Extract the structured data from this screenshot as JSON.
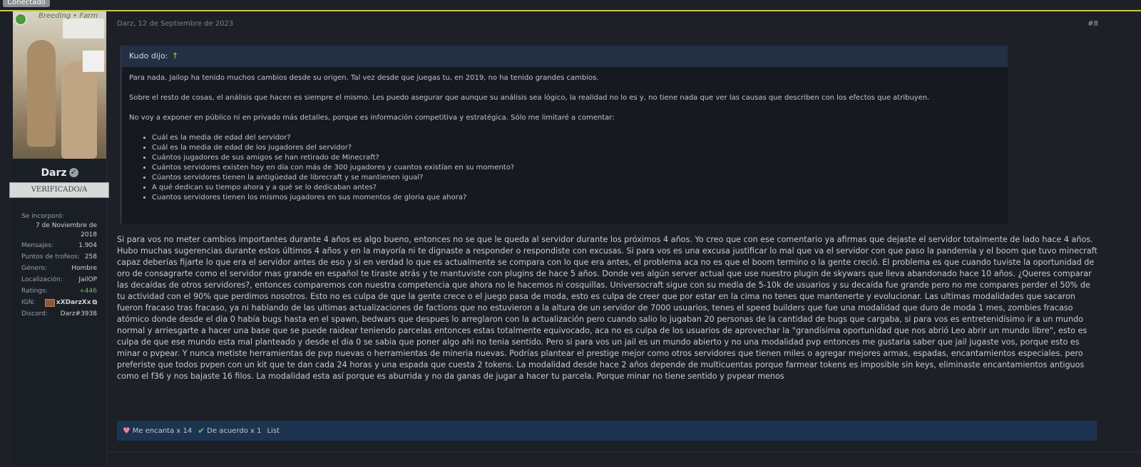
{
  "status": {
    "label": "Conectado"
  },
  "user": {
    "avatar_brand": "Breeding • Farm",
    "name": "Darz",
    "title": "VERIFICADO/A",
    "stats": {
      "joined_label": "Se incorporó:",
      "joined_value": "7 de Noviembre de 2018",
      "messages_label": "Mensajes:",
      "messages_value": "1.904",
      "trophy_label": "Puntos de trofeos:",
      "trophy_value": "258",
      "gender_label": "Género:",
      "gender_value": "Hombre",
      "location_label": "Localización:",
      "location_value": "JailOP",
      "ratings_label": "Ratings:",
      "ratings_value": "+446",
      "ign_label": "IGN:",
      "ign_value": "xXDarzXx",
      "discord_label": "Discord:",
      "discord_value": "Darz#3938"
    }
  },
  "message": {
    "date": "Darz, 12 de Septiembre de 2023",
    "number": "#8",
    "quote": {
      "author": "Kudo dijo:",
      "arrow": "↑",
      "paragraphs": [
        "Para nada. Jailop ha tenido muchos cambios desde su origen. Tal vez desde que juegas tu, en 2019, no ha tenido grandes cambios.",
        "Sobre el resto de cosas, el análisis que hacen es siempre el mismo. Les puedo asegurar que aunque su análisis sea lógico, la realidad no lo es y, no tiene nada que ver las causas que describen con los efectos que atribuyen.",
        "No voy a exponer en público ni en privado más detalles, porque es información competitiva y estratégica. Sólo me limitaré a comentar:"
      ],
      "items": [
        "Cuál es la media de edad del servidor?",
        "Cuál es la media de edad de los jugadores del servidor?",
        "Cuántos jugadores de sus amigos se han retirado de Minecraft?",
        "Cuántos servidores existen hoy en día con más de 300 jugadores y cuantos existían en su momento?",
        "Cúantos servidores tienen la antigüedad de librecraft y se mantienen igual?",
        "A qué dedican su tiempo ahora y a qué se lo dedicaban antes?",
        "Cuantos servidores tienen los mismos jugadores en sus momentos de gloria que ahora?"
      ]
    },
    "body": "Si para vos no meter cambios importantes durante 4 años es algo bueno, entonces no se que le queda al servidor durante los próximos 4 años. Yo creo que con ese comentario ya afirmas que dejaste el servidor totalmente de lado hace 4 años. Hubo muchas sugerencias durante estos últimos 4 años y en la mayoría ni te dignaste a responder o respondiste con excusas. Si para vos es una excusa justificar lo mal que va el servidor con que paso la pandemia y el boom que tuvo minecraft capaz deberías fijarte lo que era el servidor antes de eso y si en verdad lo que es actualmente se compara con lo que era antes, el problema aca no es que el boom termino o la gente creció. El problema es que cuando tuviste la oportunidad de oro de consagrarte como el servidor mas grande en español te tiraste atrás y te mantuviste con plugins de hace 5 años. Donde ves algún server actual que use nuestro plugin de skywars que lleva abandonado hace 10 años. ¿Queres comparar las decaídas de otros servidores?, entonces comparemos con nuestra competencia que ahora no le hacemos ni cosquillas. Universocraft sigue con su media de 5-10k de usuarios y su decaída fue grande pero no me compares perder el 50% de tu actividad con el 90% que perdimos nosotros. Esto no es culpa de que la gente crece o el juego pasa de moda, esto es culpa de creer que por estar en la cima no tenes que mantenerte y evolucionar. Las ultimas modalidades que sacaron fueron fracaso tras fracaso, ya ni hablando de las ultimas actualizaciones de factions que no estuvieron a la altura de un servidor de 7000 usuarios, tenes el speed builders que fue una modalidad que duro de moda 1 mes, zombies fracaso atómico donde desde el dia 0 había bugs hasta en el spawn, bedwars que despues lo arreglaron con la actualización pero cuando salio lo jugaban 20 personas de la cantidad de bugs que cargaba, si para vos es entretenidísimo ir a un mundo normal y arriesgarte a hacer una base que se puede raidear teniendo parcelas entonces estas totalmente equivocado, aca no es culpa de los usuarios de aprovechar la \"grandísima oportunidad que nos abrió Leo abrir un mundo libre\", esto es culpa de que ese mundo esta mal planteado y desde el dia 0 se sabia que poner algo ahi no tenia sentido. Pero si para vos un jail es un mundo abierto y no una modalidad pvp entonces me gustaria saber que jail jugaste vos, porque esto es minar o pvpear. Y nunca metiste herramientas de pvp nuevas o herramientas de mineria nuevas. Podrías plantear el prestige mejor como otros servidores que tienen miles o agregar mejores armas, espadas, encantamientos especiales. pero preferiste que todos pvpen con un kit que te dan cada 24 horas y una espada que cuesta 2 tokens. La modalidad desde hace 2 años depende de multicuentas porque farmear tokens es imposible sin keys, eliminaste encantamientos antiguos como el f36 y nos bajaste 16 filos. La modalidad esta así porque es aburrida y no da ganas de jugar a hacer tu parcela. Porque minar no tiene sentido y pvpear menos"
  },
  "reactions": {
    "love_label": "Me encanta x 14",
    "agree_label": "De acuerdo x 1",
    "list_label": "List",
    "love_icon": "heart-icon",
    "agree_icon": "check-icon"
  },
  "colors": {
    "accent_line": "#c9c84f",
    "reaction_bar": "#1d3450",
    "quote_head": "#233044"
  }
}
